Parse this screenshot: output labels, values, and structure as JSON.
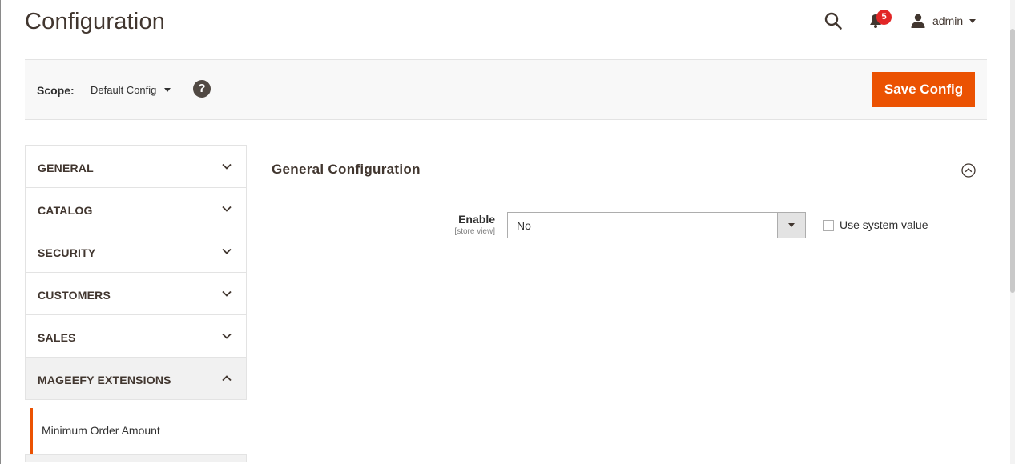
{
  "header": {
    "title": "Configuration",
    "notifications_count": "5",
    "user_name": "admin"
  },
  "scope": {
    "label": "Scope:",
    "value": "Default Config",
    "help": "?"
  },
  "toolbar": {
    "save_label": "Save Config"
  },
  "sidebar": {
    "items": [
      {
        "label": "GENERAL",
        "expanded": false
      },
      {
        "label": "CATALOG",
        "expanded": false
      },
      {
        "label": "SECURITY",
        "expanded": false
      },
      {
        "label": "CUSTOMERS",
        "expanded": false
      },
      {
        "label": "SALES",
        "expanded": false
      },
      {
        "label": "MAGEEFY EXTENSIONS",
        "expanded": true
      }
    ],
    "sub_items": [
      {
        "label": "Minimum Order Amount",
        "active": true
      }
    ]
  },
  "main": {
    "section_title": "General Configuration",
    "fields": [
      {
        "label": "Enable",
        "scope": "[store view]",
        "value": "No",
        "use_system_value_label": "Use system value",
        "use_system_value_checked": false
      }
    ]
  },
  "colors": {
    "accent": "#eb5202",
    "badge": "#e22626",
    "text_dark": "#41362f"
  },
  "icons": [
    "search-icon",
    "bell-icon",
    "user-icon",
    "help-icon",
    "chevron-down-icon",
    "chevron-up-icon",
    "collapse-circle-icon"
  ]
}
